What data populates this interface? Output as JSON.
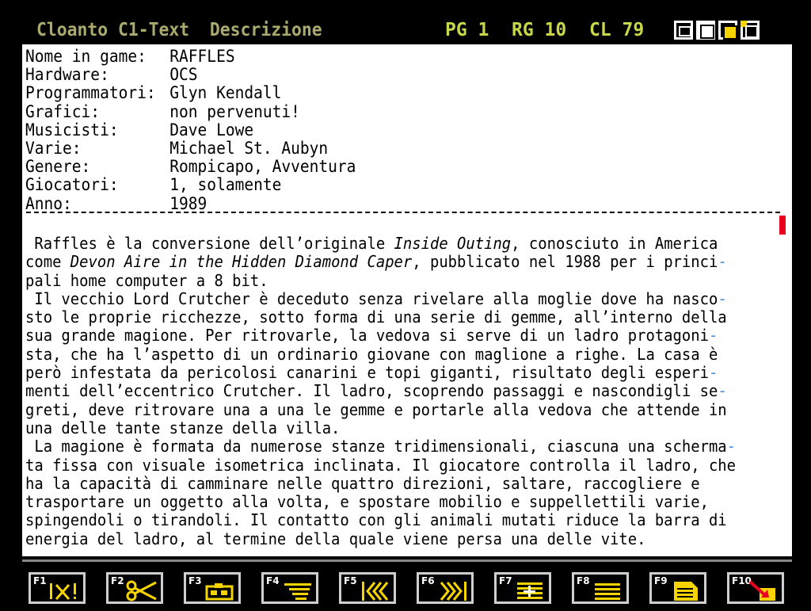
{
  "titlebar": {
    "title": "Cloanto C1-Text  Descrizione",
    "page": "PG 1",
    "row": "RG 10",
    "col": "CL 79"
  },
  "header": [
    {
      "label": "Nome in game:",
      "value": "RAFFLES"
    },
    {
      "label": "Hardware:",
      "value": "OCS"
    },
    {
      "label": "Programmatori:",
      "value": "Glyn Kendall"
    },
    {
      "label": "Grafici:",
      "value": "non pervenuti!"
    },
    {
      "label": "Musicisti:",
      "value": "Dave Lowe"
    },
    {
      "label": "Varie:",
      "value": "Michael St. Aubyn"
    },
    {
      "label": "Genere:",
      "value": "Rompicapo, Avventura"
    },
    {
      "label": "Giocatori:",
      "value": "1, solamente"
    },
    {
      "label": "Anno:",
      "value": "1989"
    }
  ],
  "body": {
    "l1a": " Raffles è la conversione dell’originale ",
    "l1b": "Inside Outing",
    "l1c": ", conosciuto in America",
    "l2a": "come ",
    "l2b": "Devon Aire in the Hidden Diamond Caper",
    "l2c": ", pubblicato nel 1988 per i princi",
    "l3": "pali home computer a 8 bit.",
    "l4": " Il vecchio Lord Crutcher è deceduto senza rivelare alla moglie dove ha nasco",
    "l5": "sto le proprie ricchezze, sotto forma di una serie di gemme, all’interno della",
    "l6": "sua grande magione. Per ritrovarle, la vedova si serve di un ladro protagoni",
    "l7": "sta, che ha l’aspetto di un ordinario giovane con maglione a righe. La casa è",
    "l8": "però infestata da pericolosi canarini e topi giganti, risultato degli esperi",
    "l9": "menti dell’eccentrico Crutcher. Il ladro, scoprendo passaggi e nascondigli se",
    "l10": "greti, deve ritrovare una a una le gemme e portarle alla vedova che attende in",
    "l11": "una delle tante stanze della villa.",
    "l12": " La magione è formata da numerose stanze tridimensionali, ciascuna una scherma",
    "l13": "ta fissa con visuale isometrica inclinata. Il giocatore controlla il ladro, che",
    "l14": "ha la capacità di camminare nelle quattro direzioni, saltare, raccogliere e",
    "l15": "trasportare un oggetto alla volta, e spostare mobilio e suppellettili varie,",
    "l16": "spingendoli o tirandoli. Il contatto con gli animali mutati riduce la barra di",
    "l17": "energia del ladro, al termine della quale viene persa una delle vite.",
    "hyphen": "-"
  },
  "fkeys": [
    {
      "num": "F1",
      "icon": "cut-alert-icon"
    },
    {
      "num": "F2",
      "icon": "scissors-icon"
    },
    {
      "num": "F3",
      "icon": "paste-icon"
    },
    {
      "num": "F4",
      "icon": "format-icon"
    },
    {
      "num": "F5",
      "icon": "rewind-icon"
    },
    {
      "num": "F6",
      "icon": "fast-forward-icon"
    },
    {
      "num": "F7",
      "icon": "insert-icon"
    },
    {
      "num": "F8",
      "icon": "justify-icon"
    },
    {
      "num": "F9",
      "icon": "document-icon"
    },
    {
      "num": "F10",
      "icon": "quit-icon"
    }
  ],
  "colors": {
    "accent": "#f5d400",
    "status": "#c8d64a",
    "title": "#aaaa6e",
    "cursor": "#e8001e"
  }
}
